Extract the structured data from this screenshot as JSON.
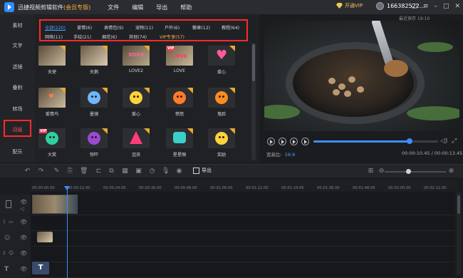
{
  "app": {
    "title": "迅捷视频剪辑软件",
    "edition": "(会员专版)",
    "menu": [
      "文件",
      "编辑",
      "导出",
      "帮助"
    ],
    "vip_label": "开通VIP",
    "username": "166382522..."
  },
  "sidebar": {
    "items": [
      {
        "label": "素材"
      },
      {
        "label": "文字"
      },
      {
        "label": "滤镜"
      },
      {
        "label": "叠附"
      },
      {
        "label": "转场"
      },
      {
        "label": "动画"
      },
      {
        "label": "配乐"
      }
    ],
    "active_index": 5
  },
  "categories": [
    {
      "label": "全部(220)",
      "active": true
    },
    {
      "label": "爱情(6)"
    },
    {
      "label": "表情包(9)"
    },
    {
      "label": "宠物(11)"
    },
    {
      "label": "户外(6)"
    },
    {
      "label": "徽章(12)"
    },
    {
      "label": "教程(64)"
    },
    {
      "label": "网络(11)"
    },
    {
      "label": "手绘(21)"
    },
    {
      "label": "烟花(6)"
    },
    {
      "label": "其他(74)"
    },
    {
      "label": "VIP专享(57)",
      "vip": true
    }
  ],
  "stickers": [
    {
      "label": "天使"
    },
    {
      "label": "天鹅"
    },
    {
      "label": "LOVE2"
    },
    {
      "label": "LOVE"
    },
    {
      "label": "爱心"
    },
    {
      "label": "爱情鸟"
    },
    {
      "label": "墨镜"
    },
    {
      "label": "爱心"
    },
    {
      "label": "愤怒"
    },
    {
      "label": "鬼脸"
    },
    {
      "label": "大笑"
    },
    {
      "label": "惊吓"
    },
    {
      "label": "沮丧"
    },
    {
      "label": "星星眼"
    },
    {
      "label": "奖励"
    }
  ],
  "preview": {
    "autosave_label": "最近保存 19:10",
    "aspect_label": "宽高比:",
    "aspect_value": "16:9",
    "timecode": "00:00:10.45 / 00:00:13.45",
    "progress_fraction": 0.77
  },
  "toolbar": {
    "export_label": "导出"
  },
  "timeline": {
    "ticks": [
      "00:00:00.00",
      "00:00:12.00",
      "00:00:24.00",
      "00:00:36.00",
      "00:00:48.00",
      "00:01:00.00",
      "00:01:12.00",
      "00:01:24.00",
      "00:01:36.00",
      "00:01:48.00",
      "00:02:00.00",
      "00:02:12.00"
    ],
    "track_labels": [
      "",
      "1",
      "",
      "2",
      ""
    ]
  }
}
